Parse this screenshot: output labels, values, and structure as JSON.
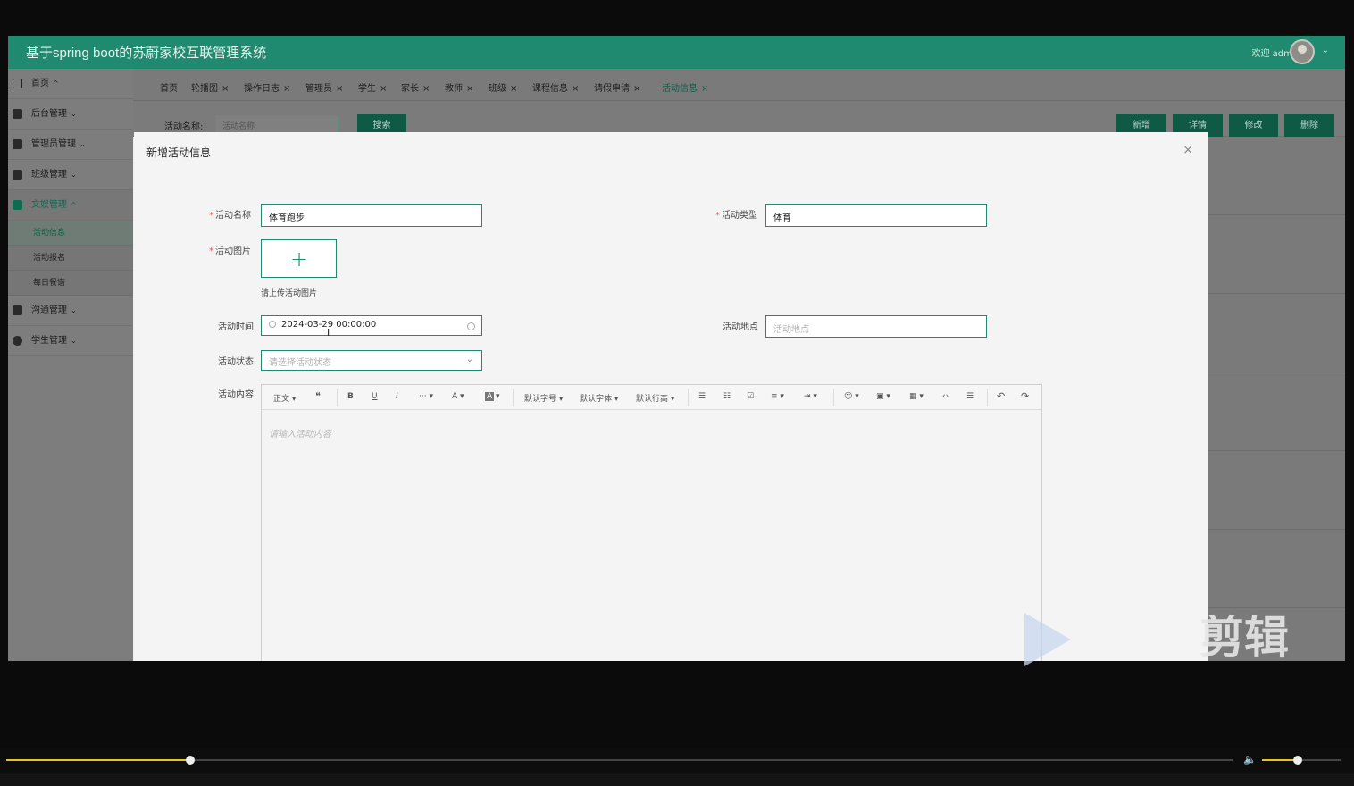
{
  "app": {
    "title": "基于spring boot的苏蔚家校互联管理系统",
    "welcome": "欢迎 admin",
    "accent_color": "#1f8a70"
  },
  "sidebar": {
    "items": [
      {
        "label": "首页",
        "icon": "home-icon"
      },
      {
        "label": "后台管理",
        "icon": "book-icon"
      },
      {
        "label": "管理员管理",
        "icon": "table-icon"
      },
      {
        "label": "班级管理",
        "icon": "card-icon"
      },
      {
        "label": "文娱管理",
        "icon": "cup-icon"
      },
      {
        "label": "沟通管理",
        "icon": "chat-icon"
      },
      {
        "label": "学生管理",
        "icon": "gauge-icon"
      }
    ],
    "subitems": [
      "活动信息",
      "活动报名",
      "每日餐谱"
    ]
  },
  "tabs": [
    "首页",
    "轮播图",
    "操作日志",
    "管理员",
    "学生",
    "家长",
    "教师",
    "班级",
    "课程信息",
    "请假申请",
    "活动信息"
  ],
  "toolbar": {
    "search_label": "活动名称:",
    "search_placeholder": "活动名称",
    "search_button": "搜索",
    "add_button": "新增",
    "detail_button": "详情",
    "edit_button": "修改",
    "delete_button": "删除"
  },
  "modal": {
    "title": "新增活动信息",
    "close": "×",
    "name_label": "活动名称",
    "name_value": "体育跑步",
    "type_label": "活动类型",
    "type_value": "体育",
    "image_label": "活动图片",
    "upload_plus": "+",
    "upload_hint": "请上传活动图片",
    "time_label": "活动时间",
    "time_value": "2024-03-29 00:00:00",
    "location_label": "活动地点",
    "location_placeholder": "活动地点",
    "status_label": "活动状态",
    "status_placeholder": "请选择活动状态",
    "content_label": "活动内容",
    "content_placeholder": "请输入活动内容"
  },
  "editor_toolbar": [
    "正文",
    "❝",
    "B",
    "U",
    "I",
    "···",
    "A",
    "A",
    "默认字号",
    "默认字体",
    "默认行高",
    "☰",
    "☷",
    "☑",
    "≡",
    "⇥",
    "☺",
    "▣",
    "▦",
    "‹›",
    "☰",
    "↶",
    "↷"
  ],
  "watermark": {
    "text": "剪辑"
  },
  "player": {
    "progress": 0.15,
    "volume": 0.45
  }
}
